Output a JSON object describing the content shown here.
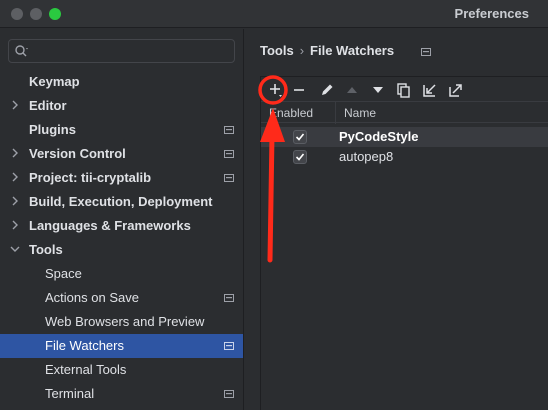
{
  "window": {
    "title": "Preferences"
  },
  "search": {
    "placeholder": ""
  },
  "sidebar": {
    "items": [
      {
        "label": "Keymap"
      },
      {
        "label": "Editor"
      },
      {
        "label": "Plugins"
      },
      {
        "label": "Version Control"
      },
      {
        "label": "Project: tii-cryptalib"
      },
      {
        "label": "Build, Execution, Deployment"
      },
      {
        "label": "Languages & Frameworks"
      },
      {
        "label": "Tools"
      },
      {
        "label": "Space"
      },
      {
        "label": "Actions on Save"
      },
      {
        "label": "Web Browsers and Preview"
      },
      {
        "label": "File Watchers"
      },
      {
        "label": "External Tools"
      },
      {
        "label": "Terminal"
      }
    ]
  },
  "breadcrumb": {
    "parent": "Tools",
    "separator": "›",
    "current": "File Watchers"
  },
  "grid": {
    "headers": {
      "enabled": "Enabled",
      "name": "Name"
    },
    "rows": [
      {
        "enabled": true,
        "name": "PyCodeStyle"
      },
      {
        "enabled": true,
        "name": "autopep8"
      }
    ]
  },
  "colors": {
    "selection": "#2e55a3",
    "annotation": "#ff2a1a",
    "maximize": "#2ac940"
  }
}
